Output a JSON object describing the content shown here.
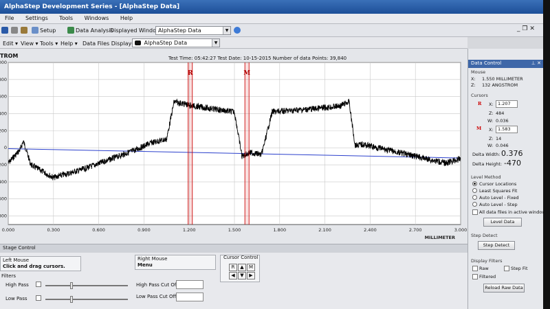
{
  "app": {
    "title": "AlphaStep Development Series - [AlphaStep Data]"
  },
  "menu": {
    "items": [
      "File",
      "Settings",
      "Tools",
      "Windows",
      "Help"
    ]
  },
  "toolbar": {
    "setup_label": "Setup",
    "data_analysis_label": "Data Analysis",
    "displayed_windows_label": "Displayed Windows:",
    "displayed_windows_value": "AlphaStep Data"
  },
  "subtoolbar": {
    "items": [
      "Edit",
      "View",
      "Tools",
      "Help"
    ],
    "data_files_label": "Data Files Displayed:",
    "data_files_value": "AlphaStep Data"
  },
  "chart_header": {
    "unit": "TROM",
    "test_time_label": "Test Time:",
    "test_time": "05:42:27",
    "test_date_label": "Test Date:",
    "test_date": "10-15-2015",
    "points_label": "Number of data Points:",
    "points": "39,840",
    "x_unit": "MILLIMETER",
    "cursor_r_label": "R",
    "cursor_m_label": "M"
  },
  "chart_data": {
    "type": "line",
    "title": "",
    "xlabel": "MILLIMETER",
    "ylabel": "",
    "xlim": [
      0,
      3.0
    ],
    "ylim": [
      -900,
      1000
    ],
    "x_ticks": [
      0.0,
      0.3,
      0.6,
      0.9,
      1.2,
      1.5,
      1.8,
      2.1,
      2.4,
      2.7,
      3.0
    ],
    "x_tick_labels": [
      "0.000",
      "0.300",
      "0.600",
      "0.900",
      "1.200",
      "1.500",
      "1.800",
      "2.100",
      "2.400",
      "2.700",
      "3.000"
    ],
    "y_ticks": [
      1000,
      800,
      600,
      400,
      200,
      0,
      -200,
      -400,
      -600,
      -800
    ],
    "y_tick_labels": [
      "000",
      "800",
      "600",
      "400",
      "200",
      "0",
      "200",
      "400",
      "600",
      "800"
    ],
    "grid": true,
    "series": [
      {
        "color": "#000000",
        "x": [
          0.0,
          0.08,
          0.1,
          0.15,
          0.3,
          0.5,
          0.7,
          0.85,
          0.95,
          1.05,
          1.1,
          1.2,
          1.3,
          1.42,
          1.5,
          1.55,
          1.6,
          1.62,
          1.68,
          1.75,
          1.9,
          2.05,
          2.2,
          2.26,
          2.3,
          2.35,
          2.5,
          2.7,
          2.9,
          3.0
        ],
        "y": [
          -180,
          -20,
          80,
          -200,
          -350,
          -250,
          -120,
          -20,
          60,
          100,
          540,
          500,
          470,
          440,
          420,
          -100,
          -60,
          -60,
          -80,
          420,
          440,
          460,
          490,
          540,
          30,
          40,
          -20,
          -100,
          -180,
          -130
        ]
      },
      {
        "color": "#2a3fcc",
        "x": [
          0.0,
          3.0
        ],
        "y": [
          -10,
          -120
        ]
      }
    ],
    "cursors": [
      {
        "label": "R",
        "x": 1.207,
        "color": "#cc0000"
      },
      {
        "label": "M",
        "x": 1.583,
        "color": "#cc0000"
      }
    ]
  },
  "bottom_panel": {
    "title": "Stage Control",
    "left_mouse_label": "Left Mouse",
    "left_mouse_value": "Click and drag cursors.",
    "right_mouse_label": "Right Mouse",
    "right_mouse_value": "Menu",
    "cursor_control_label": "Cursor Control",
    "cursor_r": "R",
    "cursor_m": "M",
    "filters_label": "Filters",
    "high_pass_label": "High Pass",
    "low_pass_label": "Low Pass",
    "high_pass_cutoff_label": "High Pass Cut Off",
    "low_pass_cutoff_label": "Low Pass Cut Off"
  },
  "data_control": {
    "title": "Data Control",
    "mouse_label": "Mouse",
    "mouse_x": "1.550 MILLIMETER",
    "mouse_z": "132 ANGSTROM",
    "cursors_label": "Cursors",
    "r_x": "1.207",
    "r_z": "484",
    "r_w": "0.036",
    "m_x": "1.583",
    "m_z": "14",
    "m_w": "0.046",
    "delta_width_label": "Delta Width:",
    "delta_width": "0.376",
    "delta_height_label": "Delta Height:",
    "delta_height": "-470",
    "level_method_label": "Level Method",
    "level_options": [
      "Cursor Locations",
      "Least Squares Fit",
      "Auto Level - Fixed",
      "Auto Level - Step"
    ],
    "all_data_files_label": "All data files in active window",
    "level_data_button": "Level Data",
    "step_detect_label": "Step Detect",
    "step_detect_button": "Step Detect",
    "display_filters_label": "Display Filters",
    "raw_label": "Raw",
    "step_fit_label": "Step Fit",
    "filtered_label": "Filtered",
    "reload_button": "Reload Raw Data"
  },
  "colors": {
    "title_bar": "#2a5ea8",
    "cursor": "#cc0000",
    "trace": "#000000",
    "baseline": "#2a3fcc"
  }
}
